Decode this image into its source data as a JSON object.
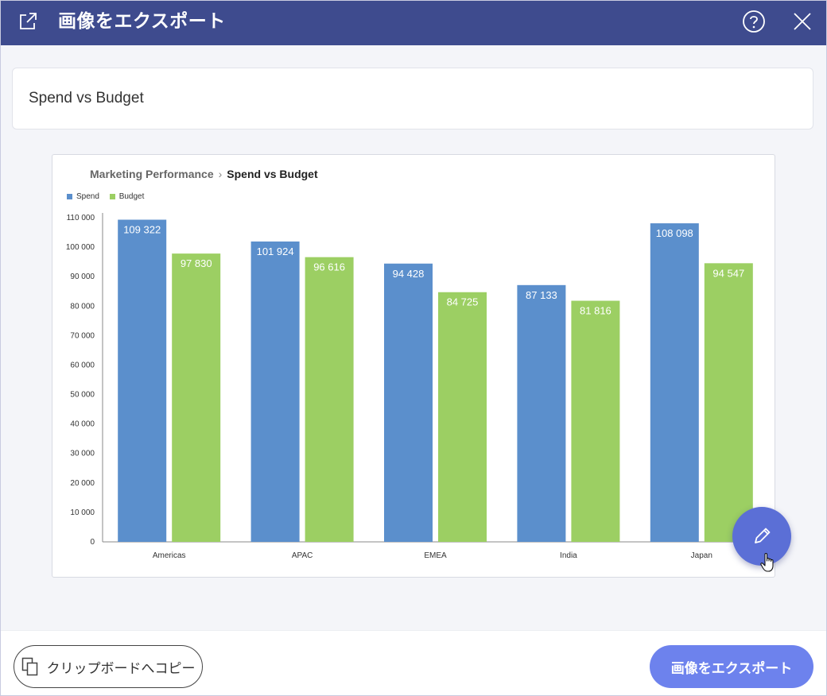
{
  "dialog": {
    "title": "画像をエクスポート",
    "icons": {
      "export": "external-link-icon",
      "help": "help-circle-icon",
      "close": "close-icon"
    }
  },
  "name_field": {
    "value": "Spend vs Budget"
  },
  "preview": {
    "breadcrumb": {
      "parent": "Marketing Performance",
      "separator": "›",
      "current": "Spend vs Budget"
    },
    "legend": [
      {
        "label": "Spend",
        "color": "#5b8fcc"
      },
      {
        "label": "Budget",
        "color": "#9ccf63"
      }
    ]
  },
  "chart_data": {
    "type": "bar",
    "categories": [
      "Americas",
      "APAC",
      "EMEA",
      "India",
      "Japan"
    ],
    "series": [
      {
        "name": "Spend",
        "color": "#5b8fcc",
        "values": [
          109322,
          101924,
          94428,
          87133,
          108098
        ],
        "labels": [
          "109 322",
          "101 924",
          "94 428",
          "87 133",
          "108 098"
        ]
      },
      {
        "name": "Budget",
        "color": "#9ccf63",
        "values": [
          97830,
          96616,
          84725,
          81816,
          94547
        ],
        "labels": [
          "97 830",
          "96 616",
          "84 725",
          "81 816",
          "94 547"
        ]
      }
    ],
    "ylim": [
      0,
      110000
    ],
    "yticks": [
      0,
      10000,
      20000,
      30000,
      40000,
      50000,
      60000,
      70000,
      80000,
      90000,
      100000,
      110000
    ],
    "ytick_labels": [
      "0",
      "10 000",
      "20 000",
      "30 000",
      "40 000",
      "50 000",
      "60 000",
      "70 000",
      "80 000",
      "90 000",
      "100 000",
      "110 000"
    ],
    "xlabel": "",
    "ylabel": "",
    "grid": false,
    "legend": "top-left"
  },
  "fab": {
    "icon": "pencil-icon"
  },
  "footer": {
    "copy_label": "クリップボードへコピー",
    "copy_icon": "copy-icon",
    "export_label": "画像をエクスポート"
  }
}
